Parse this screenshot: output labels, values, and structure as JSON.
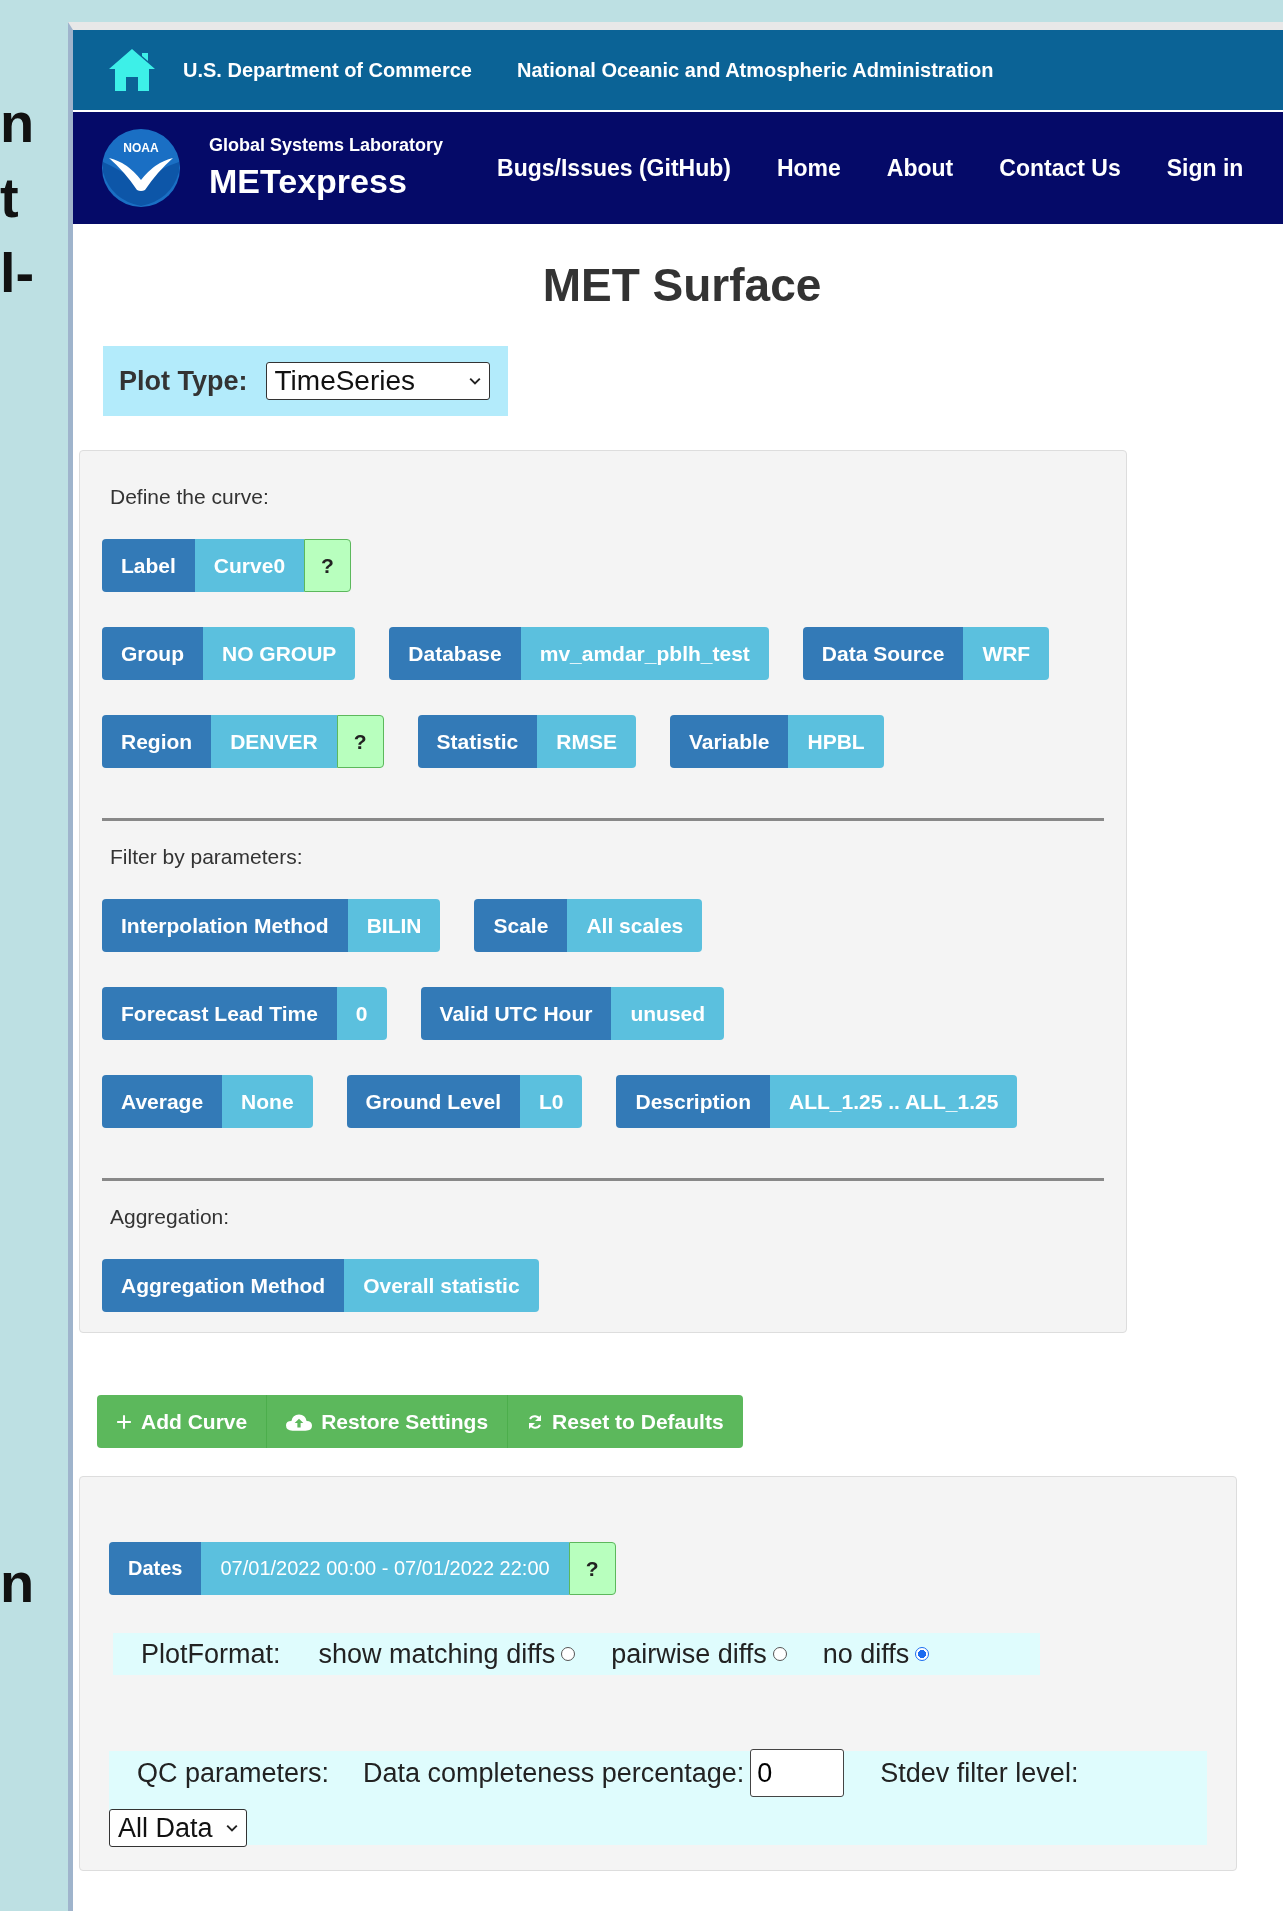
{
  "slide_text": [
    "n",
    "t",
    "l-",
    "n"
  ],
  "agency_bar": {
    "department": "U.S. Department of Commerce",
    "agency": "National Oceanic and Atmospheric Administration"
  },
  "navbar": {
    "logo_text": "NOAA",
    "lab": "Global Systems Laboratory",
    "app": "METexpress",
    "links": [
      "Bugs/Issues (GitHub)",
      "Home",
      "About",
      "Contact Us",
      "Sign in"
    ]
  },
  "title": "MET Surface",
  "plot_type": {
    "label": "Plot Type:",
    "value": "TimeSeries"
  },
  "curve_panel": {
    "sections": [
      {
        "heading": "Define the curve:",
        "rows": [
          [
            {
              "label": "Label",
              "value": "Curve0",
              "help": "?"
            }
          ],
          [
            {
              "label": "Group",
              "value": "NO GROUP"
            },
            {
              "label": "Database",
              "value": "mv_amdar_pblh_test"
            },
            {
              "label": "Data Source",
              "value": "WRF"
            }
          ],
          [
            {
              "label": "Region",
              "value": "DENVER",
              "help": "?"
            },
            {
              "label": "Statistic",
              "value": "RMSE"
            },
            {
              "label": "Variable",
              "value": "HPBL"
            }
          ]
        ]
      },
      {
        "heading": "Filter by parameters:",
        "rows": [
          [
            {
              "label": "Interpolation Method",
              "value": "BILIN"
            },
            {
              "label": "Scale",
              "value": "All scales"
            }
          ],
          [
            {
              "label": "Forecast Lead Time",
              "value": "0"
            },
            {
              "label": "Valid UTC Hour",
              "value": "unused"
            }
          ],
          [
            {
              "label": "Average",
              "value": "None"
            },
            {
              "label": "Ground Level",
              "value": "L0"
            },
            {
              "label": "Description",
              "value": "ALL_1.25 .. ALL_1.25"
            }
          ]
        ]
      },
      {
        "heading": "Aggregation:",
        "rows": [
          [
            {
              "label": "Aggregation Method",
              "value": "Overall statistic"
            }
          ]
        ]
      }
    ]
  },
  "actions": [
    {
      "kind": "plus",
      "label": "Add Curve"
    },
    {
      "kind": "cloud",
      "label": "Restore Settings"
    },
    {
      "kind": "refresh",
      "label": "Reset to Defaults"
    }
  ],
  "dates": {
    "label": "Dates",
    "value": "07/01/2022 00:00 - 07/01/2022 22:00",
    "help": "?"
  },
  "plot_format": {
    "label": "PlotFormat:",
    "options": [
      {
        "label": "show matching diffs",
        "selected": false
      },
      {
        "label": "pairwise diffs",
        "selected": false
      },
      {
        "label": "no diffs",
        "selected": true
      }
    ]
  },
  "qc": {
    "label": "QC parameters:",
    "completeness_label": "Data completeness percentage:",
    "completeness_value": "0",
    "stdev_label": "Stdev filter level:",
    "stdev_value": "All Data"
  }
}
